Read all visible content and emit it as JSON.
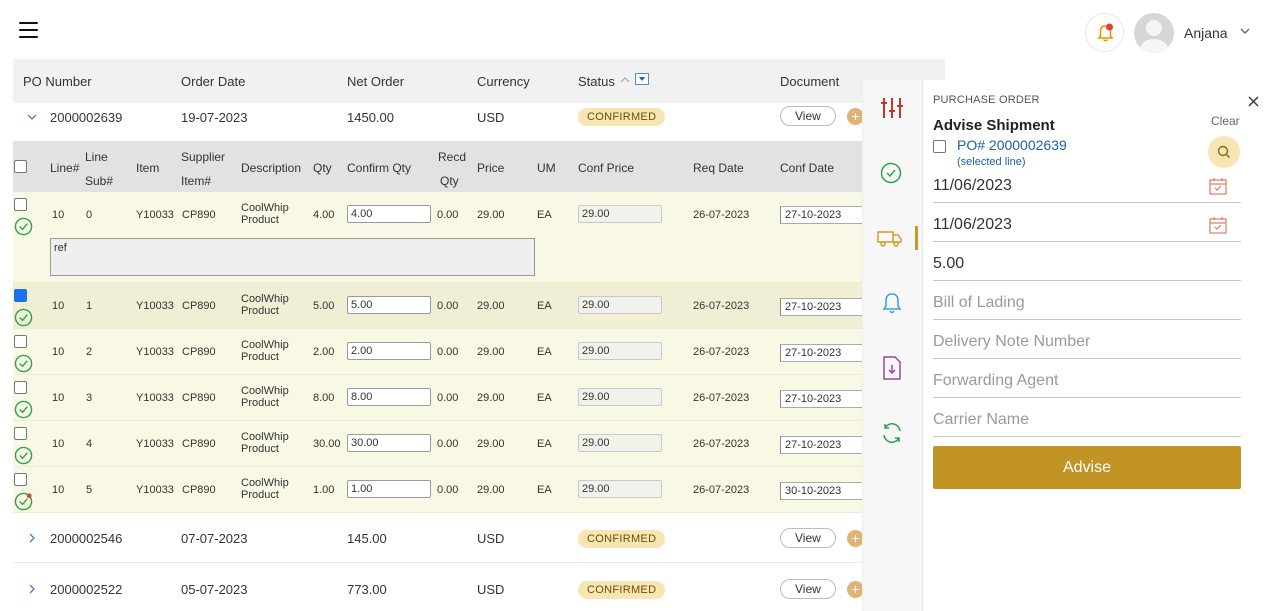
{
  "header": {
    "user_name": "Anjana"
  },
  "table": {
    "columns": [
      "PO Number",
      "Order Date",
      "Net Order",
      "Currency",
      "Status",
      "Document"
    ],
    "view_label": "View",
    "plus_label": "+",
    "orders": [
      {
        "po": "2000002639",
        "date": "19-07-2023",
        "net": "1450.00",
        "currency": "USD",
        "status": "CONFIRMED"
      },
      {
        "po": "2000002546",
        "date": "07-07-2023",
        "net": "145.00",
        "currency": "USD",
        "status": "CONFIRMED"
      },
      {
        "po": "2000002522",
        "date": "05-07-2023",
        "net": "773.00",
        "currency": "USD",
        "status": "CONFIRMED"
      }
    ],
    "sub_columns": {
      "line": "Line#",
      "line_sub_1": "Line",
      "line_sub_2": "Sub#",
      "item": "Item",
      "supplier_1": "Supplier",
      "supplier_2": "Item#",
      "description": "Description",
      "qty": "Qty",
      "confirm_qty": "Confirm Qty",
      "recd_1": "Recd",
      "recd_2": "Qty",
      "price": "Price",
      "um": "UM",
      "conf_price": "Conf Price",
      "req_date": "Req Date",
      "conf_date": "Conf Date"
    },
    "remark_text": "ref",
    "lines": [
      {
        "line": "10",
        "sub": "0",
        "item": "Y10033",
        "supplier": "CP890",
        "desc_1": "CoolWhip",
        "desc_2": "Product",
        "qty": "4.00",
        "confirm_qty": "4.00",
        "recd": "0.00",
        "price": "29.00",
        "um": "EA",
        "conf_price": "29.00",
        "req_date": "26-07-2023",
        "conf_date": "27-10-2023",
        "checked": false
      },
      {
        "line": "10",
        "sub": "1",
        "item": "Y10033",
        "supplier": "CP890",
        "desc_1": "CoolWhip",
        "desc_2": "Product",
        "qty": "5.00",
        "confirm_qty": "5.00",
        "recd": "0.00",
        "price": "29.00",
        "um": "EA",
        "conf_price": "29.00",
        "req_date": "26-07-2023",
        "conf_date": "27-10-2023",
        "checked": true
      },
      {
        "line": "10",
        "sub": "2",
        "item": "Y10033",
        "supplier": "CP890",
        "desc_1": "CoolWhip",
        "desc_2": "Product",
        "qty": "2.00",
        "confirm_qty": "2.00",
        "recd": "0.00",
        "price": "29.00",
        "um": "EA",
        "conf_price": "29.00",
        "req_date": "26-07-2023",
        "conf_date": "27-10-2023",
        "checked": false
      },
      {
        "line": "10",
        "sub": "3",
        "item": "Y10033",
        "supplier": "CP890",
        "desc_1": "CoolWhip",
        "desc_2": "Product",
        "qty": "8.00",
        "confirm_qty": "8.00",
        "recd": "0.00",
        "price": "29.00",
        "um": "EA",
        "conf_price": "29.00",
        "req_date": "26-07-2023",
        "conf_date": "27-10-2023",
        "checked": false
      },
      {
        "line": "10",
        "sub": "4",
        "item": "Y10033",
        "supplier": "CP890",
        "desc_1": "CoolWhip",
        "desc_2": "Product",
        "qty": "30.00",
        "confirm_qty": "30.00",
        "recd": "0.00",
        "price": "29.00",
        "um": "EA",
        "conf_price": "29.00",
        "req_date": "26-07-2023",
        "conf_date": "27-10-2023",
        "checked": false
      },
      {
        "line": "10",
        "sub": "5",
        "item": "Y10033",
        "supplier": "CP890",
        "desc_1": "CoolWhip",
        "desc_2": "Product",
        "qty": "1.00",
        "confirm_qty": "1.00",
        "recd": "0.00",
        "price": "29.00",
        "um": "EA",
        "conf_price": "29.00",
        "req_date": "26-07-2023",
        "conf_date": "30-10-2023",
        "checked": false
      }
    ]
  },
  "rail_icons": [
    "sliders-icon",
    "check-circle-icon",
    "truck-icon",
    "bell-icon",
    "document-download-icon",
    "refresh-icon"
  ],
  "panel": {
    "section_label": "PURCHASE ORDER",
    "title": "Advise Shipment",
    "clear_label": "Clear",
    "po_label": "PO# 2000002639",
    "selected_line_label": "(selected line)",
    "date_1": "11/06/2023",
    "date_2": "11/06/2023",
    "quantity": "5.00",
    "bill_of_lading_placeholder": "Bill of Lading",
    "delivery_note_placeholder": "Delivery Note Number",
    "forwarding_agent_placeholder": "Forwarding Agent",
    "carrier_name_placeholder": "Carrier Name",
    "advise_label": "Advise"
  },
  "colors": {
    "accent": "#c29426",
    "badge_bg": "#f7e6b4",
    "line_bg": "#f8f8e4",
    "check_green": "#2ea44f",
    "rail_red": "#c0392b"
  }
}
